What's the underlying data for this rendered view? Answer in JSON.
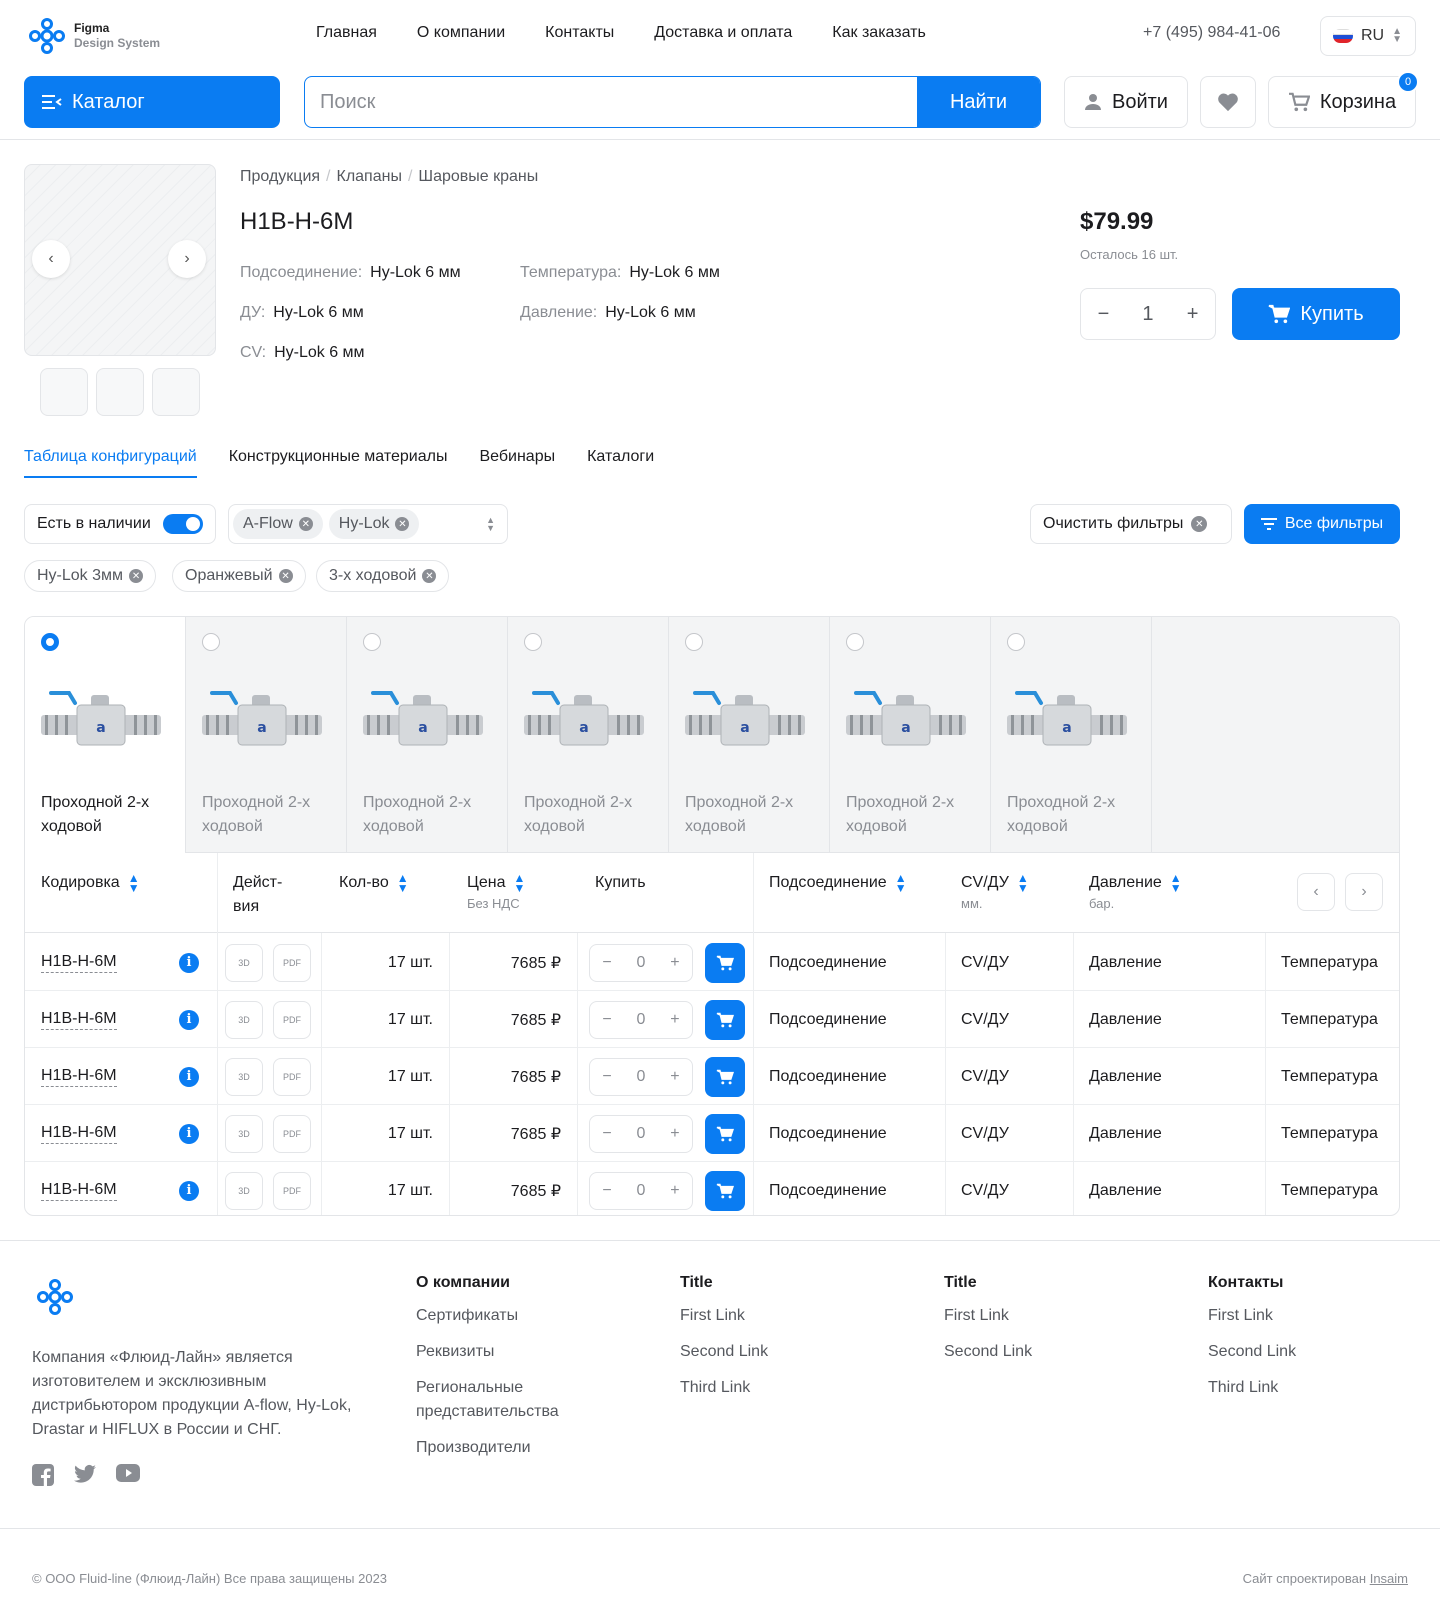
{
  "header": {
    "logo_line1": "Figma",
    "logo_line2": "Design System",
    "nav": [
      "Главная",
      "О компании",
      "Контакты",
      "Доставка и оплата",
      "Как заказать"
    ],
    "phone": "+7 (495) 984-41-06",
    "lang": "RU",
    "catalog_label": "Каталог",
    "search_placeholder": "Поиск",
    "search_button": "Найти",
    "login_label": "Войти",
    "cart_label": "Корзина",
    "cart_count": "0",
    "accent_color": "#0a7cf2"
  },
  "product": {
    "breadcrumbs": [
      "Продукция",
      "Клапаны",
      "Шаровые краны"
    ],
    "title": "H1B-H-6M",
    "specs_left": [
      {
        "key": "Подсоединение:",
        "value": "Hy-Lok 6 мм"
      },
      {
        "key": "ДУ:",
        "value": "Hy-Lok 6 мм"
      },
      {
        "key": "CV:",
        "value": "Hy-Lok 6 мм"
      }
    ],
    "specs_right": [
      {
        "key": "Температура:",
        "value": "Hy-Lok 6 мм"
      },
      {
        "key": "Давление:",
        "value": "Hy-Lok 6 мм"
      }
    ],
    "price": "$79.99",
    "stock": "Осталось 16 шт.",
    "quantity": "1",
    "buy_label": "Купить"
  },
  "tabs": [
    "Таблица конфигураций",
    "Конструкционные материалы",
    "Вебинары",
    "Каталоги"
  ],
  "filters": {
    "in_stock_label": "Есть в наличии",
    "in_stock_on": true,
    "brand_chips": [
      "A-Flow",
      "Hy-Lok"
    ],
    "clear_label": "Очистить фильтры",
    "all_filters_label": "Все фильтры",
    "active_chips": [
      "Hy-Lok 3мм",
      "Оранжевый",
      "3-х ходовой"
    ]
  },
  "variants": [
    {
      "name": "Проходной 2-х ходовой",
      "selected": true
    },
    {
      "name": "Проходной 2-х ходовой",
      "selected": false
    },
    {
      "name": "Проходной 2-х ходовой",
      "selected": false
    },
    {
      "name": "Проходной 2-х ходовой",
      "selected": false
    },
    {
      "name": "Проходной 2-х ходовой",
      "selected": false
    },
    {
      "name": "Проходной 2-х ходовой",
      "selected": false
    },
    {
      "name": "Проходной 2-х ходовой",
      "selected": false
    }
  ],
  "table": {
    "columns": {
      "code": "Кодировка",
      "actions": "Дейст-вия",
      "qty": "Кол-во",
      "price": "Цена",
      "price_sub": "Без НДС",
      "buy": "Купить",
      "connection": "Подсоединение",
      "cv": "CV/ДУ",
      "cv_sub": "мм.",
      "pressure": "Давление",
      "pressure_sub": "бар."
    },
    "rows": [
      {
        "code": "H1B-H-6M",
        "qty": "17 шт.",
        "price": "7685 ₽",
        "count": "0",
        "connection": "Подсоединение",
        "cv": "CV/ДУ",
        "pressure": "Давление",
        "temp": "Температура"
      },
      {
        "code": "H1B-H-6M",
        "qty": "17 шт.",
        "price": "7685 ₽",
        "count": "0",
        "connection": "Подсоединение",
        "cv": "CV/ДУ",
        "pressure": "Давление",
        "temp": "Температура"
      },
      {
        "code": "H1B-H-6M",
        "qty": "17 шт.",
        "price": "7685 ₽",
        "count": "0",
        "connection": "Подсоединение",
        "cv": "CV/ДУ",
        "pressure": "Давление",
        "temp": "Температура"
      },
      {
        "code": "H1B-H-6M",
        "qty": "17 шт.",
        "price": "7685 ₽",
        "count": "0",
        "connection": "Подсоединение",
        "cv": "CV/ДУ",
        "pressure": "Давление",
        "temp": "Температура"
      },
      {
        "code": "H1B-H-6M",
        "qty": "17 шт.",
        "price": "7685 ₽",
        "count": "0",
        "connection": "Подсоединение",
        "cv": "CV/ДУ",
        "pressure": "Давление",
        "temp": "Температура"
      }
    ]
  },
  "footer": {
    "about_text": "Компания «Флюид-Лайн» является изготовителем и эксклюзивным дистрибьютором продукции A-flow, Hy-Lok, Drastar и HIFLUX в России и СНГ.",
    "social_icons": [
      "facebook-icon",
      "twitter-icon",
      "youtube-icon"
    ],
    "columns": [
      {
        "title": "О компании",
        "links": [
          "Сертификаты",
          "Реквизиты",
          "Региональные представительства",
          "Производители"
        ]
      },
      {
        "title": "Title",
        "links": [
          "First Link",
          "Second Link",
          "Third Link"
        ]
      },
      {
        "title": "Title",
        "links": [
          "First Link",
          "Second Link"
        ]
      },
      {
        "title": "Контакты",
        "links": [
          "First Link",
          "Second Link",
          "Third Link"
        ]
      }
    ],
    "copyright": "© ООО Fluid-line (Флюид-Лайн) Все права защищены 2023",
    "made_by_prefix": "Сайт спроектирован",
    "made_by_link": "Insaim"
  }
}
